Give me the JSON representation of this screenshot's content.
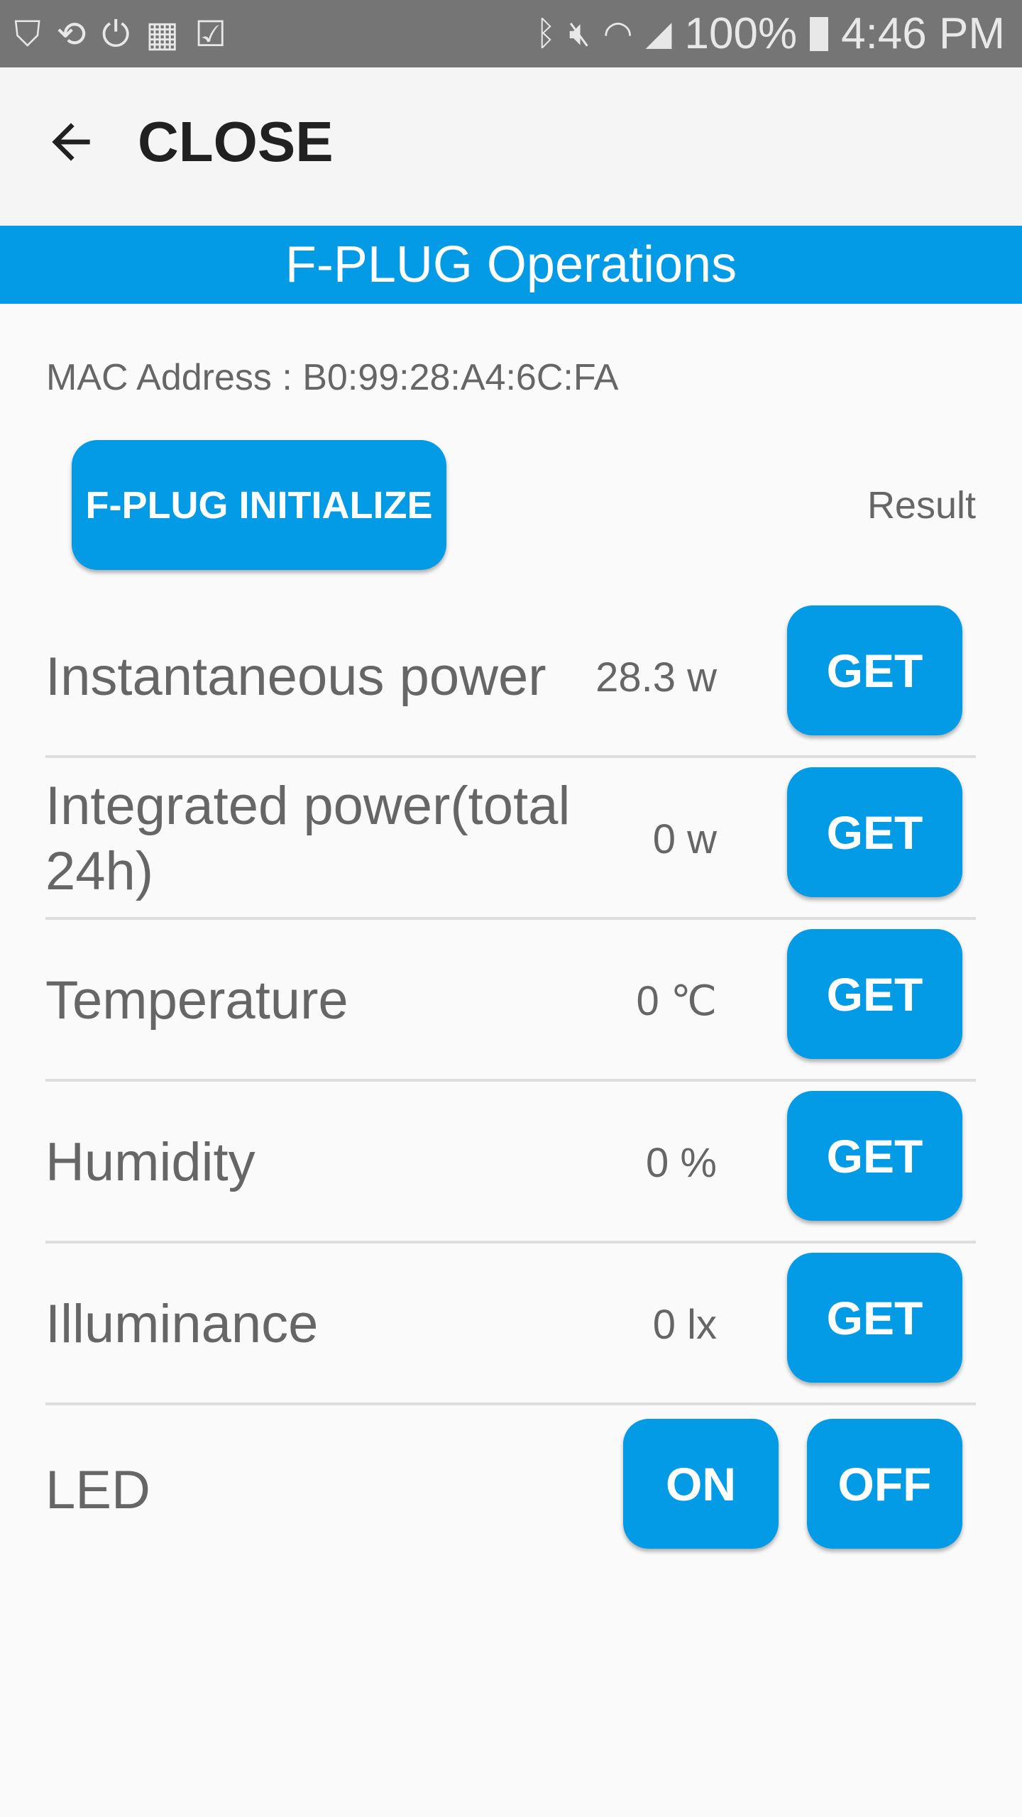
{
  "status_bar": {
    "left_icons": [
      "shield-icon",
      "sync-icon",
      "power-icon",
      "sim-off-icon",
      "clipboard-check-icon"
    ],
    "battery": "100%",
    "time": "4:46 PM"
  },
  "toolbar": {
    "close_label": "CLOSE"
  },
  "title": "F-PLUG Operations",
  "mac_address": "MAC Address : B0:99:28:A4:6C:FA",
  "initialize_label": "F-PLUG INITIALIZE",
  "result_label": "Result",
  "rows": [
    {
      "label": "Instantaneous power",
      "value": "28.3 w",
      "button": "GET"
    },
    {
      "label": "Integrated power(total 24h)",
      "value": "0 w",
      "button": "GET"
    },
    {
      "label": "Temperature",
      "value": "0 ℃",
      "button": "GET"
    },
    {
      "label": "Humidity",
      "value": "0 %",
      "button": "GET"
    },
    {
      "label": "Illuminance",
      "value": "0 lx",
      "button": "GET"
    }
  ],
  "led": {
    "label": "LED",
    "on": "ON",
    "off": "OFF"
  },
  "colors": {
    "accent": "#039be5",
    "status_bar": "#757575"
  }
}
